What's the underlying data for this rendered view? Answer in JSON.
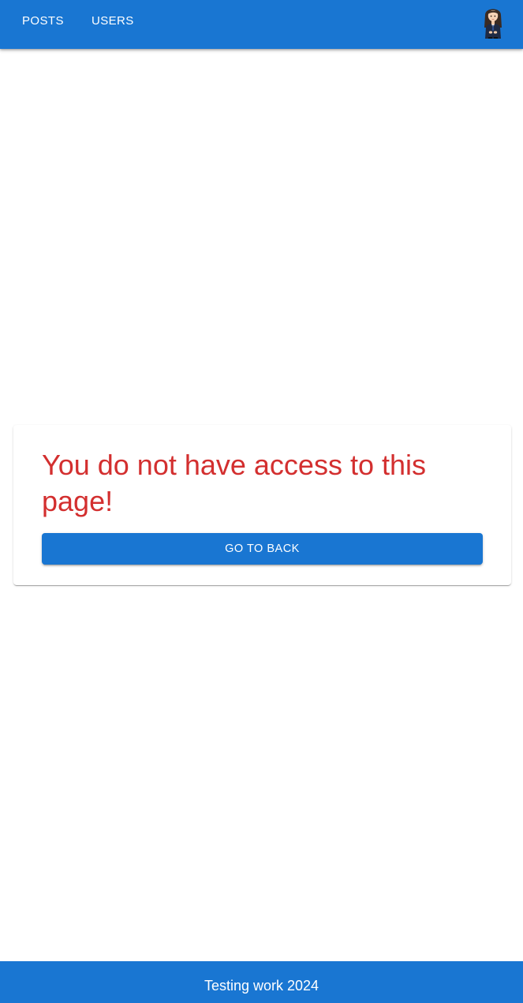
{
  "header": {
    "nav": {
      "posts_label": "POSTS",
      "users_label": "USERS"
    },
    "avatar_icon": "user-avatar-icon"
  },
  "main": {
    "message": "You do not have access to this page!",
    "back_button_label": "GO TO BACK"
  },
  "footer": {
    "text": "Testing work 2024"
  },
  "colors": {
    "primary": "#1976d2",
    "error": "#d32f2f",
    "background": "#ffffff"
  }
}
